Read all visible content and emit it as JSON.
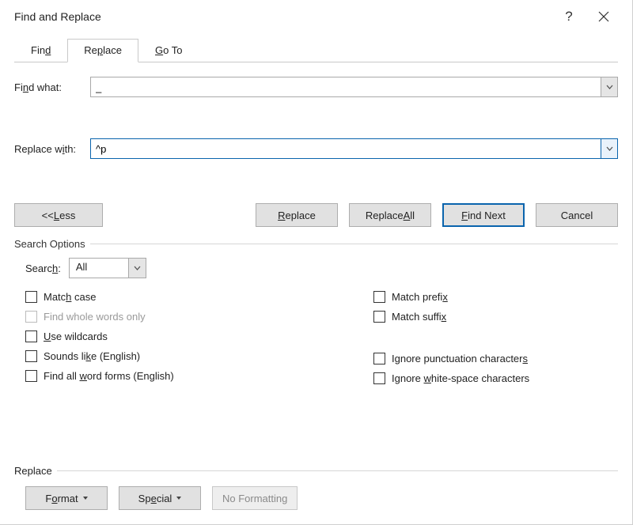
{
  "window": {
    "title": "Find and Replace",
    "help_symbol": "?"
  },
  "tabs": {
    "find": "Find",
    "replace": "Replace",
    "goto": "Go To",
    "active": "replace"
  },
  "fields": {
    "find_label": "Find what:",
    "find_value": "_",
    "replace_label": "Replace with:",
    "replace_value": "^p"
  },
  "buttons": {
    "less": "<< Less",
    "replace": "Replace",
    "replace_all": "Replace All",
    "find_next": "Find Next",
    "cancel": "Cancel"
  },
  "search_options": {
    "section_title": "Search Options",
    "search_label": "Search:",
    "search_value": "All",
    "left": {
      "match_case": "Match case",
      "whole_words": "Find whole words only",
      "wildcards": "Use wildcards",
      "sounds_like": "Sounds like (English)",
      "all_word_forms": "Find all word forms (English)"
    },
    "right": {
      "match_prefix": "Match prefix",
      "match_suffix": "Match suffix",
      "ignore_punct": "Ignore punctuation characters",
      "ignore_ws": "Ignore white-space characters"
    }
  },
  "replace_section": {
    "title": "Replace",
    "format": "Format",
    "special": "Special",
    "no_formatting": "No Formatting"
  }
}
